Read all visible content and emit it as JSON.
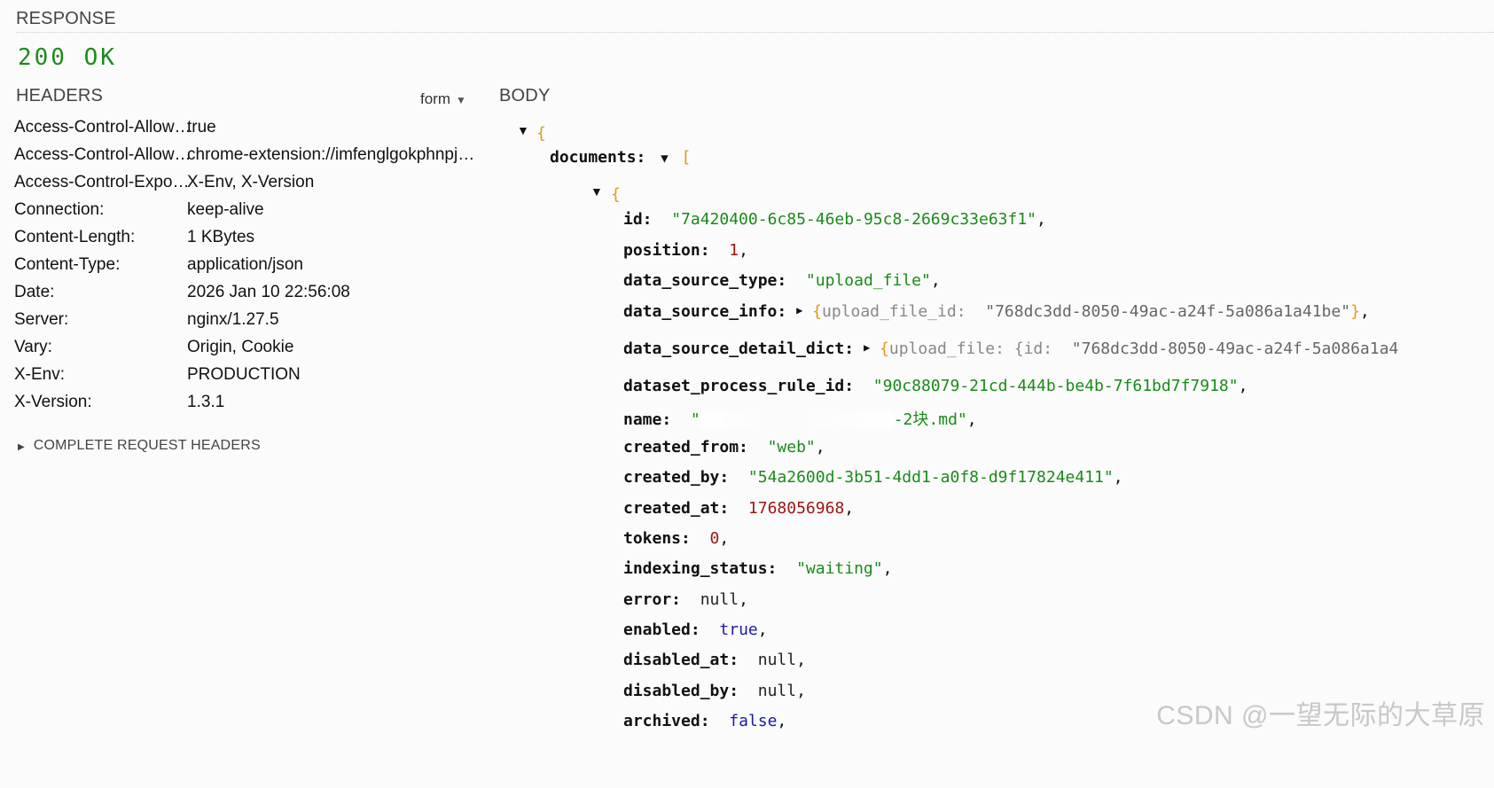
{
  "response": {
    "title": "RESPONSE",
    "status": "200 OK"
  },
  "headers_panel": {
    "title": "HEADERS",
    "view_mode": "form",
    "rows": [
      {
        "name": "Access-Control-Allow…",
        "value": "true"
      },
      {
        "name": "Access-Control-Allow…",
        "value": "chrome-extension://imfenglgokphnpj…"
      },
      {
        "name": "Access-Control-Expo…",
        "value": "X-Env, X-Version"
      },
      {
        "name": "Connection:",
        "value": "keep-alive"
      },
      {
        "name": "Content-Length:",
        "value": "1 KBytes"
      },
      {
        "name": "Content-Type:",
        "value": "application/json"
      },
      {
        "name": "Date:",
        "value": "2026 Jan 10 22:56:08"
      },
      {
        "name": "Server:",
        "value": "nginx/1.27.5"
      },
      {
        "name": "Vary:",
        "value": "Origin, Cookie"
      },
      {
        "name": "X-Env:",
        "value": "PRODUCTION"
      },
      {
        "name": "X-Version:",
        "value": "1.3.1"
      }
    ],
    "complete_request_headers": "COMPLETE REQUEST HEADERS"
  },
  "body_panel": {
    "title": "BODY",
    "open_brace": "{",
    "open_bracket": "[",
    "documents_key": "documents:",
    "fields": {
      "id": {
        "key": "id:",
        "value": "\"7a420400-6c85-46eb-95c8-2669c33e63f1\""
      },
      "position": {
        "key": "position:",
        "value": "1"
      },
      "data_source_type": {
        "key": "data_source_type:",
        "value": "\"upload_file\""
      },
      "data_source_info": {
        "key": "data_source_info:",
        "preview_key": "upload_file_id:",
        "preview_value": "\"768dc3dd-8050-49ac-a24f-5a086a1a41be\""
      },
      "data_source_detail_dict": {
        "key": "data_source_detail_dict:",
        "preview_key": "upload_file:",
        "preview_inner": "{id:",
        "preview_value": "\"768dc3dd-8050-49ac-a24f-5a086a1a4"
      },
      "dataset_process_rule_id": {
        "key": "dataset_process_rule_id:",
        "value": "\"90c88079-21cd-444b-be4b-7f61bd7f7918\""
      },
      "name": {
        "key": "name:",
        "value_start": "\"",
        "value_end": "-2块.md\""
      },
      "created_from": {
        "key": "created_from:",
        "value": "\"web\""
      },
      "created_by": {
        "key": "created_by:",
        "value": "\"54a2600d-3b51-4dd1-a0f8-d9f17824e411\""
      },
      "created_at": {
        "key": "created_at:",
        "value": "1768056968"
      },
      "tokens": {
        "key": "tokens:",
        "value": "0"
      },
      "indexing_status": {
        "key": "indexing_status:",
        "value": "\"waiting\""
      },
      "error": {
        "key": "error:",
        "value": "null"
      },
      "enabled": {
        "key": "enabled:",
        "value": "true"
      },
      "disabled_at": {
        "key": "disabled_at:",
        "value": "null"
      },
      "disabled_by": {
        "key": "disabled_by:",
        "value": "null"
      },
      "archived": {
        "key": "archived:",
        "value": "false"
      }
    }
  },
  "watermark": "CSDN @一望无际的大草原",
  "colors": {
    "status_ok": "#1e8a1e",
    "json_string": "#1a8a1a",
    "json_number": "#9b1515",
    "json_boolean": "#1a1aa6",
    "json_brace": "#e39a18"
  }
}
